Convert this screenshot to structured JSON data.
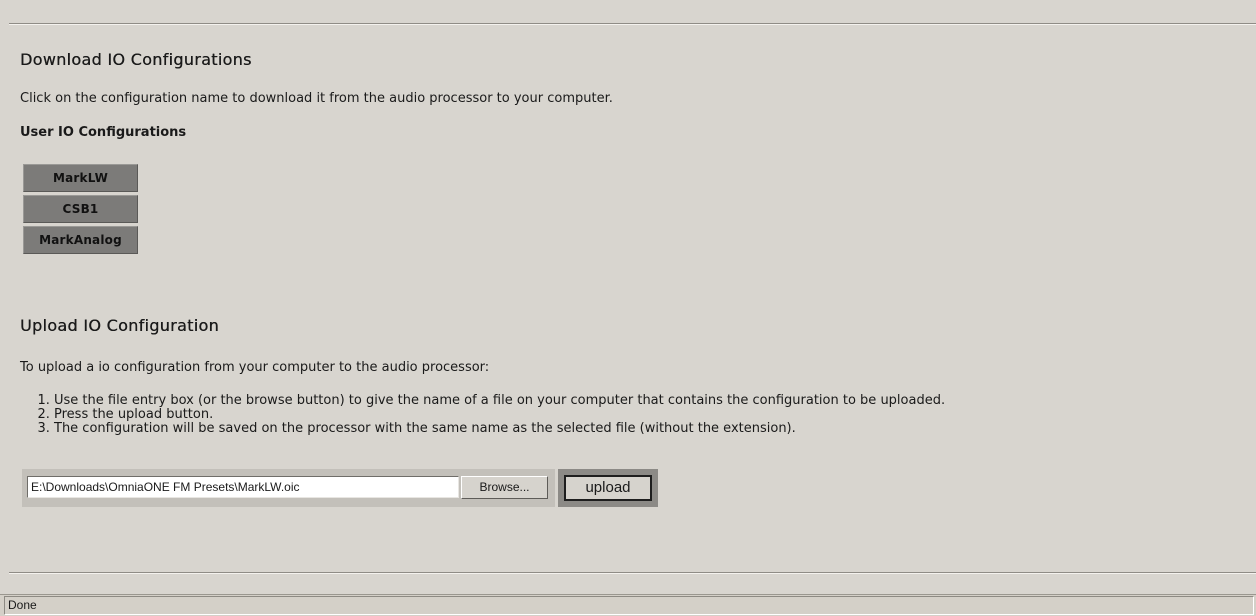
{
  "download": {
    "heading": "Download IO Configurations",
    "description": "Click on the configuration name to download it from the audio processor to your computer.",
    "user_heading": "User IO Configurations",
    "configurations": [
      "MarkLW",
      "CSB1",
      "MarkAnalog"
    ]
  },
  "upload": {
    "heading": "Upload IO Configuration",
    "description": "To upload a io configuration from your computer to the audio processor:",
    "steps": [
      "Use the file entry box (or the browse button) to give the name of a file on your computer that contains the configuration to be uploaded.",
      "Press the upload button.",
      "The configuration will be saved on the processor with the same name as the selected file (without the extension)."
    ],
    "file_value": "E:\\Downloads\\OmniaONE FM Presets\\MarkLW.oic",
    "browse_label": "Browse...",
    "upload_label": "upload"
  },
  "status_bar": {
    "text": "Done"
  }
}
